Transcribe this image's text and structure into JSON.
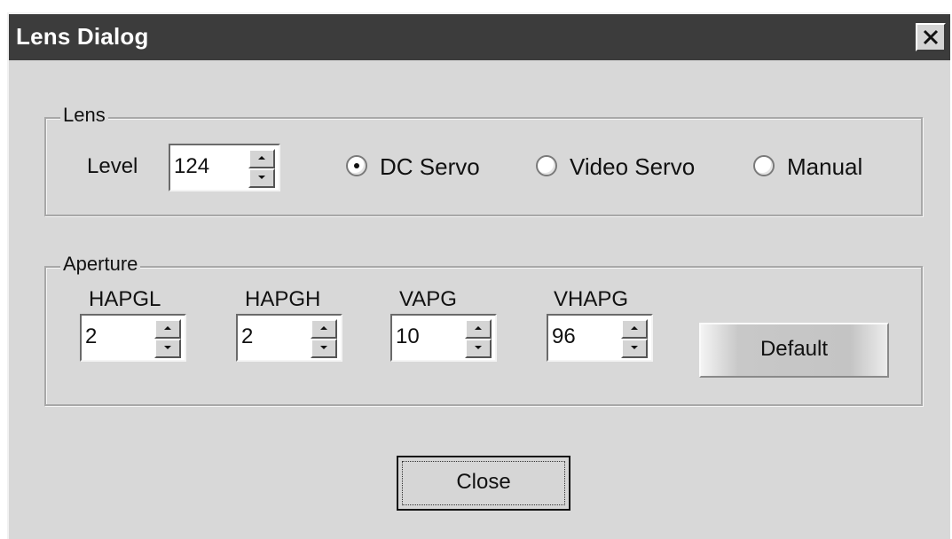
{
  "window": {
    "title": "Lens Dialog"
  },
  "lens_group": {
    "label": "Lens",
    "level_label": "Level",
    "level_value": "124",
    "modes": [
      {
        "label": "DC Servo",
        "selected": true
      },
      {
        "label": "Video Servo",
        "selected": false
      },
      {
        "label": "Manual",
        "selected": false
      }
    ]
  },
  "aperture_group": {
    "label": "Aperture",
    "fields": [
      {
        "label": "HAPGL",
        "value": "2"
      },
      {
        "label": "HAPGH",
        "value": "2"
      },
      {
        "label": "VAPG",
        "value": "10"
      },
      {
        "label": "VHAPG",
        "value": "96"
      }
    ],
    "default_label": "Default"
  },
  "footer": {
    "close_label": "Close"
  },
  "icons": {
    "close": "close-icon",
    "spin_up": "arrow-up-icon",
    "spin_down": "arrow-down-icon"
  }
}
